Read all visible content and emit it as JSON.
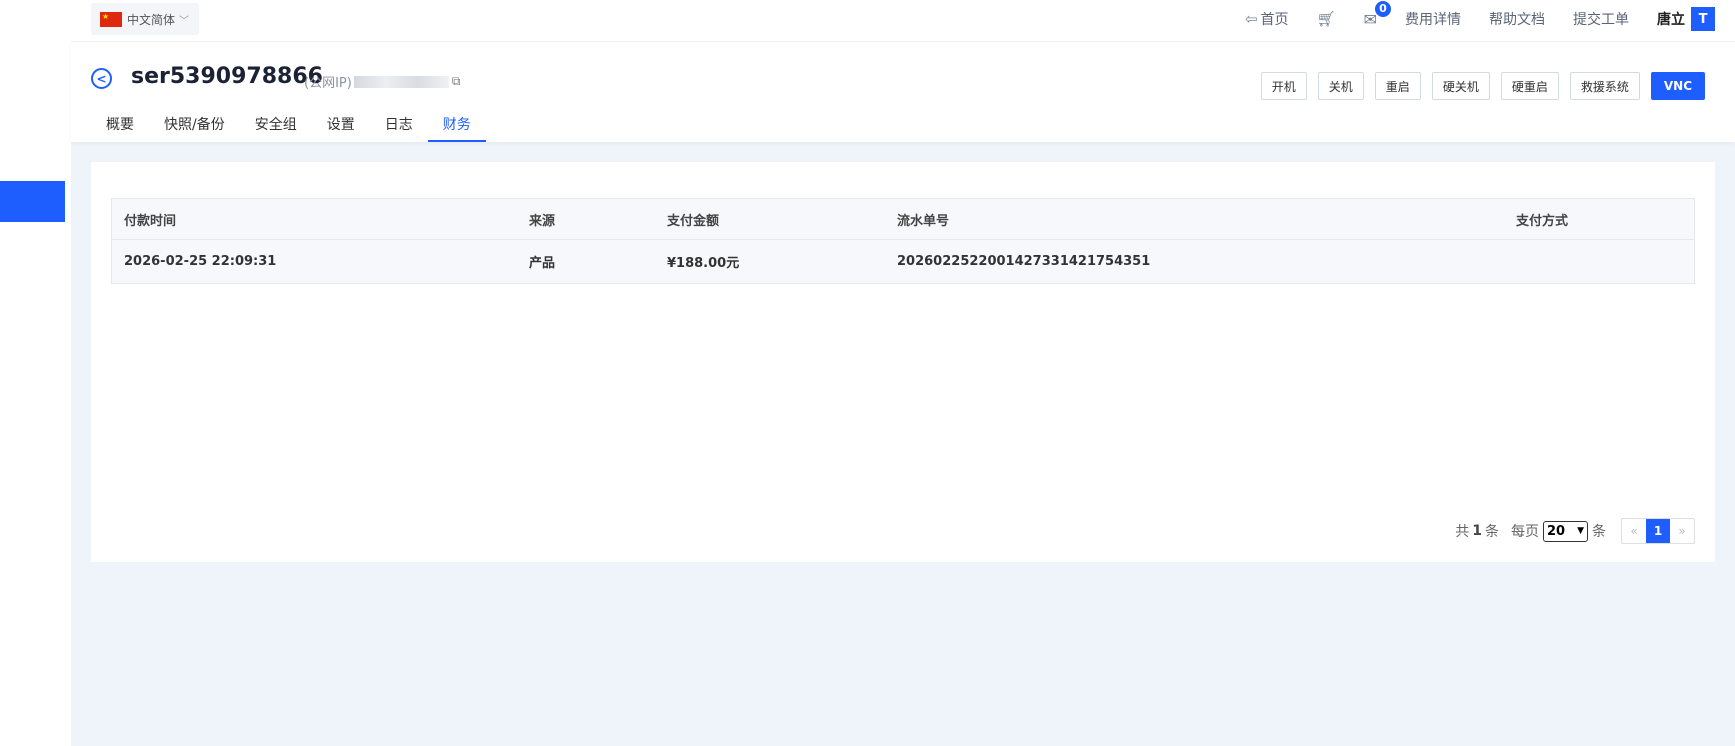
{
  "header": {
    "language": "中文简体",
    "nav": [
      "首页",
      "费用详情",
      "帮助文档",
      "提交工单"
    ],
    "home": "首页",
    "billing": "费用详情",
    "docs": "帮助文档",
    "ticket": "提交工单",
    "mail_count": "0",
    "user_name": "唐立",
    "avatar_letter": "T"
  },
  "server": {
    "name": "ser5390978866",
    "ip_label": "(公网IP)"
  },
  "actions": {
    "power_on": "开机",
    "power_off": "关机",
    "restart": "重启",
    "hard_off": "硬关机",
    "hard_restart": "硬重启",
    "rescue": "救援系统",
    "vnc": "VNC"
  },
  "tabs": {
    "overview": "概要",
    "snapshot": "快照/备份",
    "security_group": "安全组",
    "settings": "设置",
    "logs": "日志",
    "finance": "财务"
  },
  "table": {
    "columns": {
      "time": "付款时间",
      "source": "来源",
      "amount": "支付金额",
      "serial": "流水单号",
      "method": "支付方式"
    },
    "rows": [
      {
        "time": "2026-02-25 22:09:31",
        "source": "产品",
        "amount": "¥188.00元",
        "serial": "20260225220014273314217543​51",
        "method": ""
      }
    ]
  },
  "pagination": {
    "total_prefix": "共",
    "total": "1",
    "total_suffix": "条",
    "per_page_prefix": "每页",
    "per_page": "20",
    "per_page_suffix": "条",
    "prev": "«",
    "current": "1",
    "next": "»"
  },
  "colors": {
    "accent": "#1e5eff",
    "background": "#eff3fa"
  }
}
